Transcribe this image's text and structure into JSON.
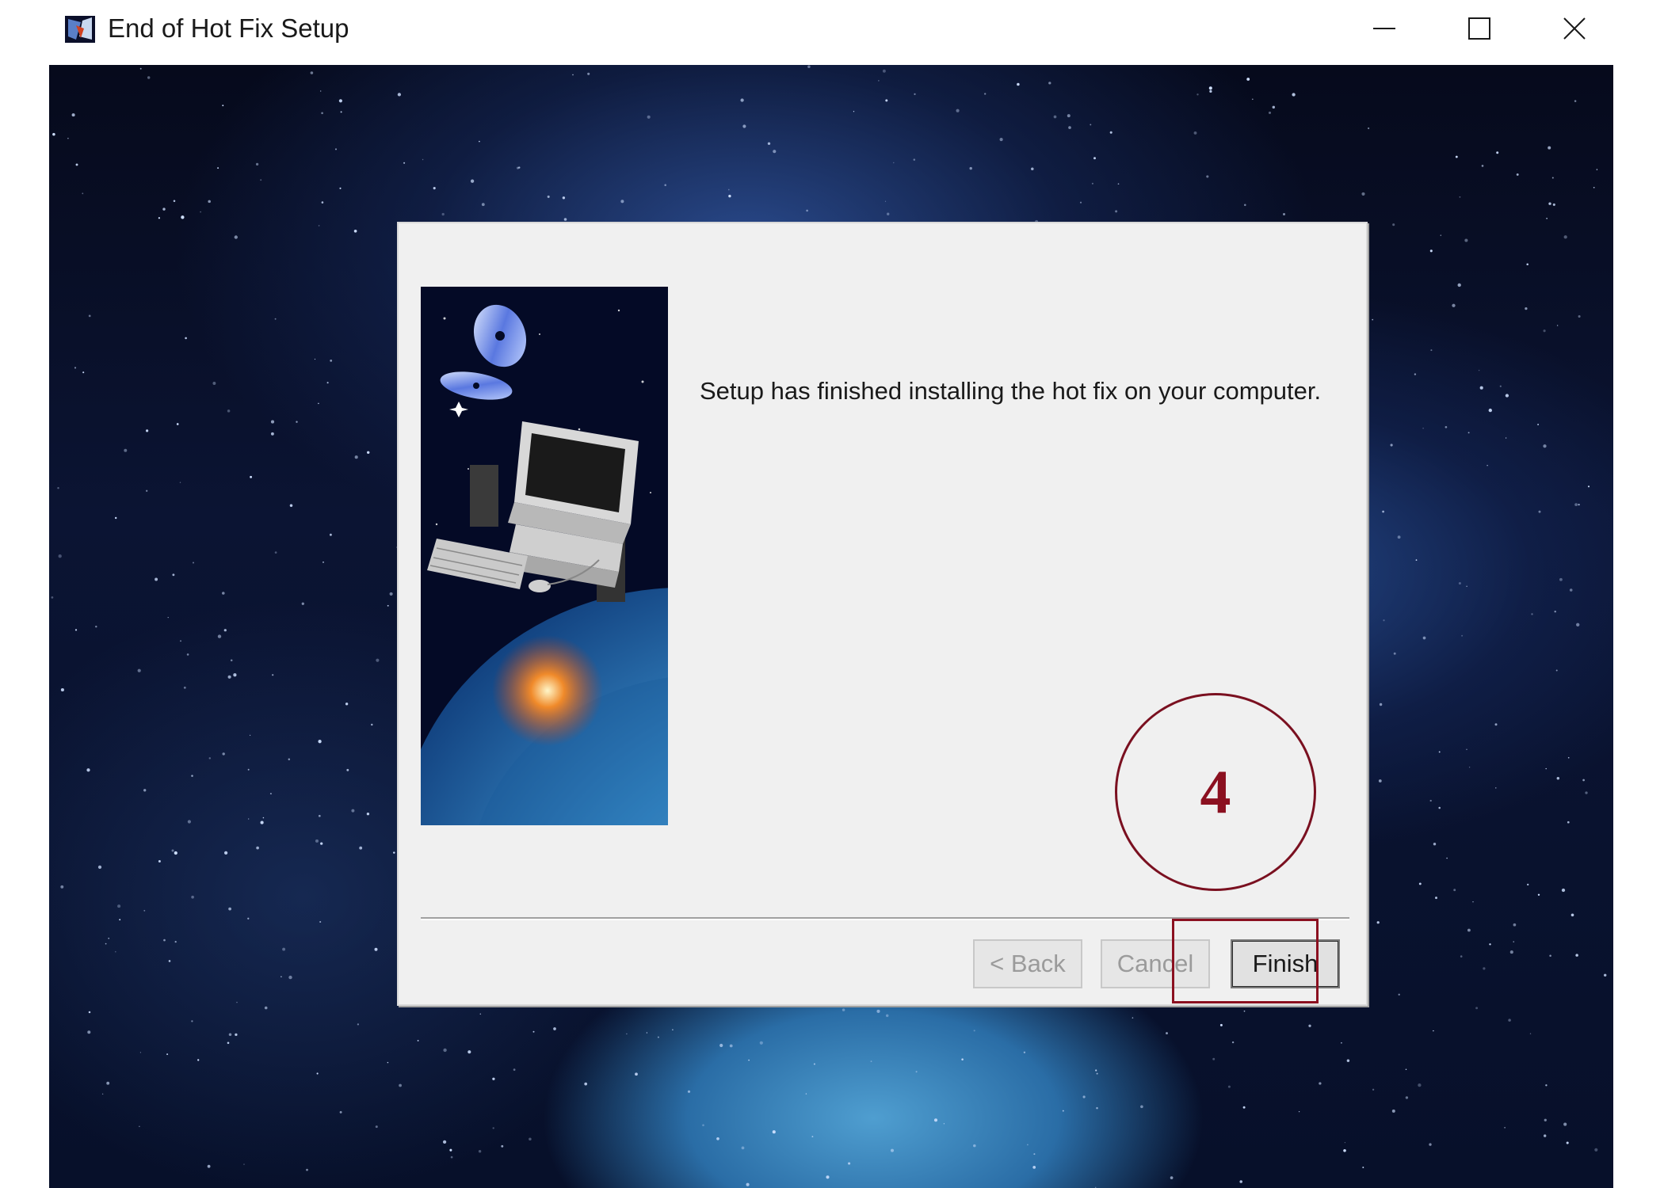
{
  "window": {
    "title": "End of Hot Fix Setup",
    "icon": "setup-app-icon",
    "controls": [
      "minimize-icon",
      "maximize-icon",
      "close-icon"
    ]
  },
  "dialog": {
    "message": "Setup has finished installing the hot fix on your computer.",
    "side_image": "computer-in-space-illustration",
    "buttons": {
      "back": "< Back",
      "cancel": "Cancel",
      "finish": "Finish"
    }
  },
  "annotation": {
    "step_number": "4",
    "color": "#8b1020"
  },
  "colors": {
    "dialog_bg": "#f0f0f0",
    "disabled_text": "#9b9b9b",
    "titlebar_bg": "#ffffff"
  }
}
